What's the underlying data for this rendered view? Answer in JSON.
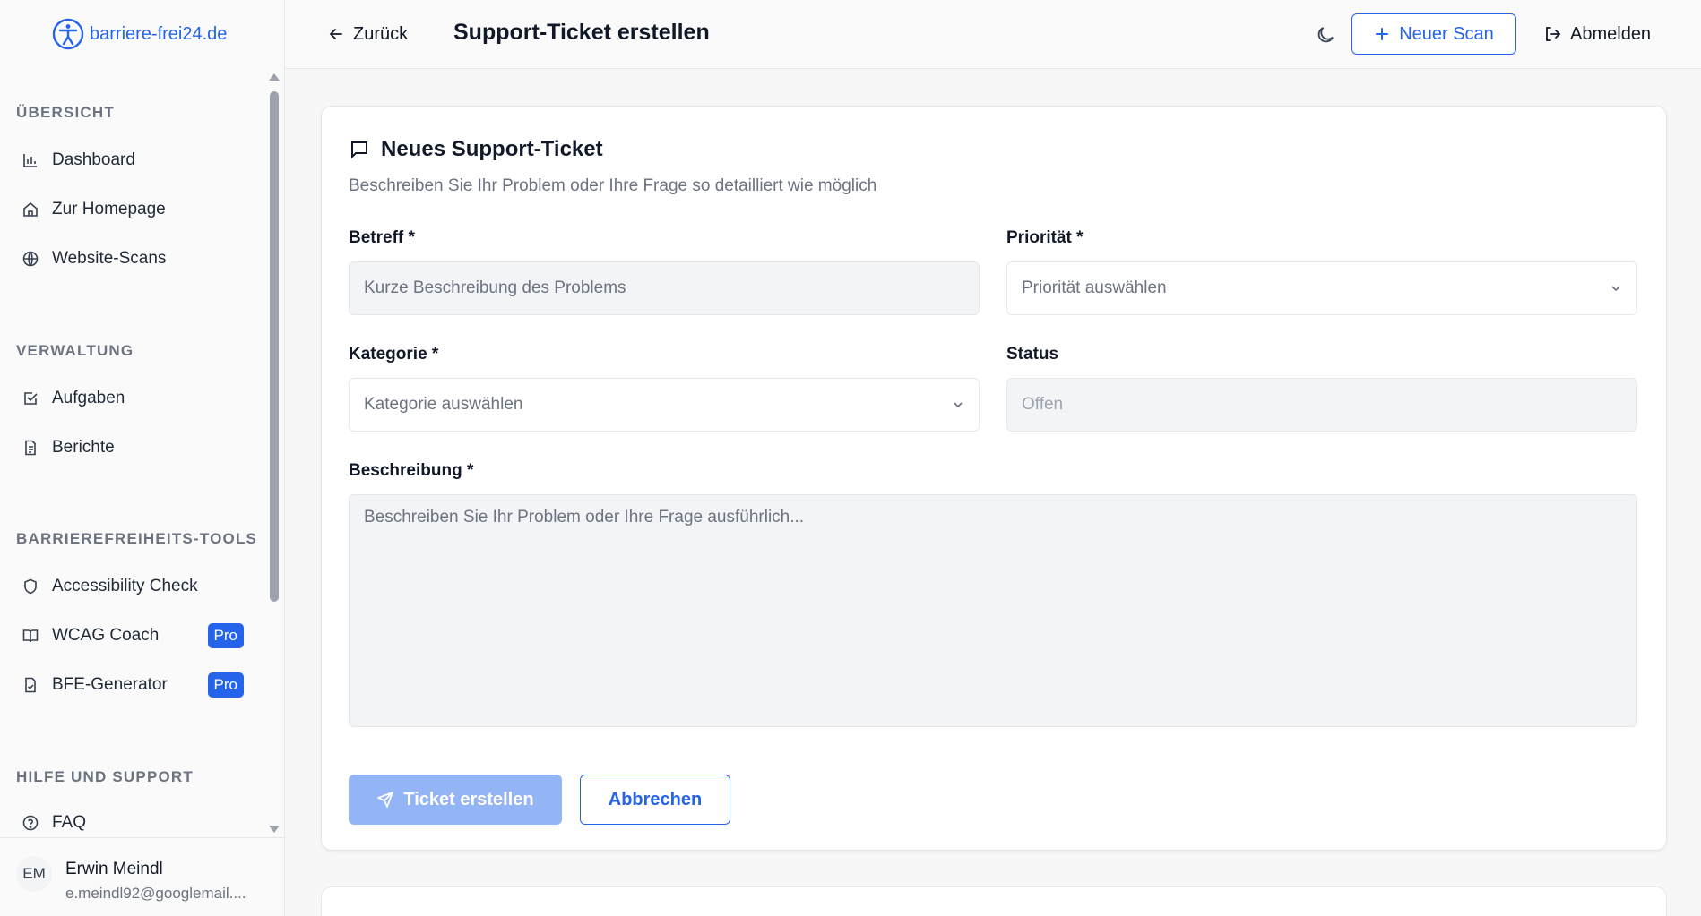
{
  "brand": {
    "name": "barriere-frei24.de",
    "accent": "#2563eb"
  },
  "sidebar": {
    "sections": [
      {
        "title": "ÜBERSICHT",
        "items": [
          {
            "label": "Dashboard",
            "icon": "bar-chart-icon"
          },
          {
            "label": "Zur Homepage",
            "icon": "home-icon"
          },
          {
            "label": "Website-Scans",
            "icon": "globe-icon"
          }
        ]
      },
      {
        "title": "VERWALTUNG",
        "items": [
          {
            "label": "Aufgaben",
            "icon": "checkbox-icon"
          },
          {
            "label": "Berichte",
            "icon": "document-icon"
          }
        ]
      },
      {
        "title": "BARRIEREFREIHEITS-TOOLS",
        "items": [
          {
            "label": "Accessibility Check",
            "icon": "shield-icon"
          },
          {
            "label": "WCAG Coach",
            "icon": "book-icon",
            "badge": "Pro"
          },
          {
            "label": "BFE-Generator",
            "icon": "file-check-icon",
            "badge": "Pro"
          }
        ]
      },
      {
        "title": "HILFE UND SUPPORT",
        "items": [
          {
            "label": "FAQ",
            "icon": "help-circle-icon"
          }
        ]
      }
    ]
  },
  "user": {
    "initials": "EM",
    "name": "Erwin Meindl",
    "email": "e.meindl92@googlemail...."
  },
  "header": {
    "back_label": "Zurück",
    "title": "Support-Ticket erstellen",
    "new_scan_label": "Neuer Scan",
    "logout_label": "Abmelden"
  },
  "form": {
    "title": "Neues Support-Ticket",
    "subtitle": "Beschreiben Sie Ihr Problem oder Ihre Frage so detailliert wie möglich",
    "subject_label": "Betreff *",
    "subject_placeholder": "Kurze Beschreibung des Problems",
    "priority_label": "Priorität *",
    "priority_placeholder": "Priorität auswählen",
    "category_label": "Kategorie *",
    "category_placeholder": "Kategorie auswählen",
    "status_label": "Status",
    "status_value": "Offen",
    "description_label": "Beschreibung *",
    "description_placeholder": "Beschreiben Sie Ihr Problem oder Ihre Frage ausführlich...",
    "submit_label": "Ticket erstellen",
    "cancel_label": "Abbrechen"
  }
}
